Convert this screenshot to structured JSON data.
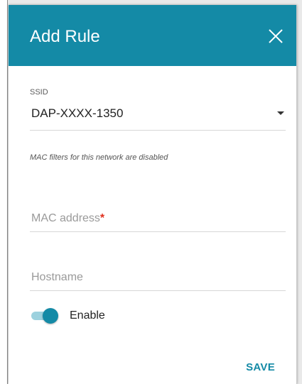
{
  "dialog": {
    "title": "Add Rule",
    "close_icon": "close-icon"
  },
  "ssid": {
    "label": "SSID",
    "value": "DAP-XXXX-1350",
    "caret_icon": "caret-down-icon"
  },
  "hint": "MAC filters for this network are disabled",
  "mac_address": {
    "placeholder": "MAC address",
    "required_mark": "*",
    "value": ""
  },
  "hostname": {
    "placeholder": "Hostname",
    "value": ""
  },
  "enable": {
    "label": "Enable",
    "on": true
  },
  "actions": {
    "save_label": "SAVE"
  },
  "colors": {
    "accent": "#148aa6",
    "required": "#e0301e"
  }
}
